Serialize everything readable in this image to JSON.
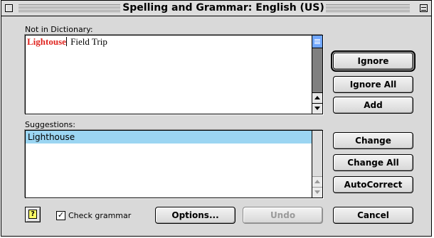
{
  "window": {
    "title": "Spelling and Grammar: English (US)"
  },
  "not_in_dictionary": {
    "label": "Not in Dictionary:",
    "error_word": "Lightouse",
    "rest_text": " Field Trip"
  },
  "suggestions": {
    "label": "Suggestions:",
    "items": [
      "Lighthouse"
    ]
  },
  "buttons": {
    "ignore": "Ignore",
    "ignore_all": "Ignore All",
    "add": "Add",
    "change": "Change",
    "change_all": "Change All",
    "autocorrect": "AutoCorrect",
    "options": "Options...",
    "undo": "Undo",
    "cancel": "Cancel"
  },
  "help": {
    "glyph": "?"
  },
  "check_grammar": {
    "label": "Check grammar",
    "checked": true,
    "mark": "✓"
  },
  "colors": {
    "error_word": "#e0241f",
    "selection": "#9bd5f2",
    "scroll_thumb": "#6fa6ff"
  }
}
